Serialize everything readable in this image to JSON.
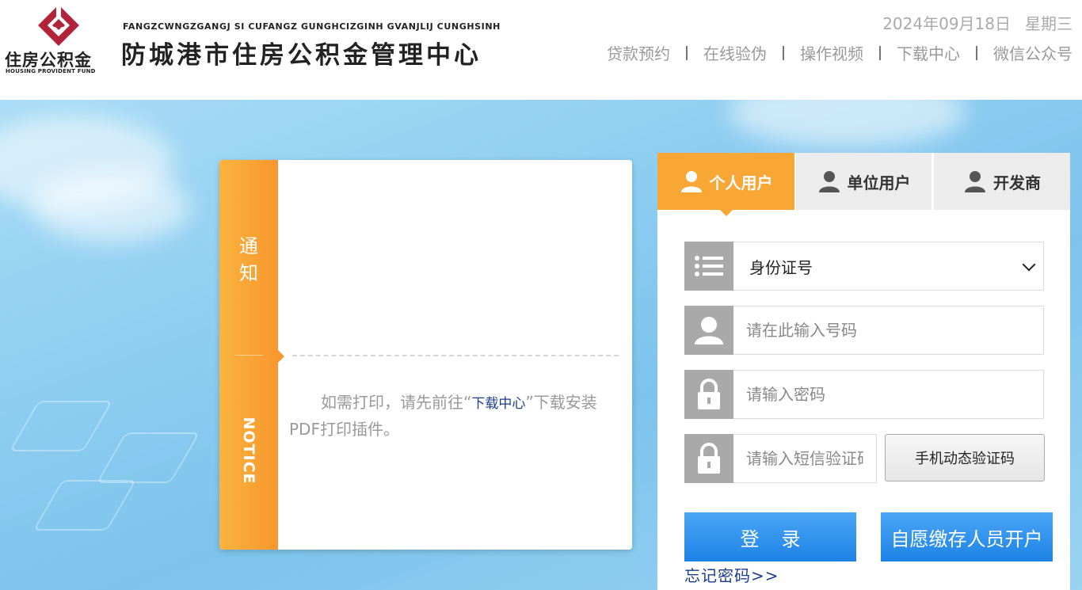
{
  "header": {
    "logo_cn": "住房公积金",
    "logo_en": "HOUSING PROVIDENT FUND",
    "site_pinyin": "FANGZCWNGZGANGJ SI CUFANGZ GUNGHCIZGINH GVANJLIJ CUNGHSINH",
    "site_title": "防城港市住房公积金管理中心",
    "date": "2024年09月18日",
    "weekday": "星期三",
    "nav": [
      "贷款预约",
      "在线验伪",
      "操作视频",
      "下载中心",
      "微信公众号"
    ]
  },
  "notice": {
    "side_cn": "通知",
    "side_en": "NOTICE",
    "text_before": "如需打印，请先前往“",
    "link": "下载中心",
    "text_after": "”下载安装PDF打印插件。"
  },
  "login": {
    "tabs": [
      "个人用户",
      "单位用户",
      "开发商"
    ],
    "active_tab": 0,
    "id_type": "身份证号",
    "id_placeholder": "请在此输入号码",
    "password_placeholder": "请输入密码",
    "sms_placeholder": "请输入短信验证码",
    "sms_button": "手机动态验证码",
    "login_button": "登录",
    "open_account_button": "自愿缴存人员开户",
    "forgot_link": "忘记密码>>"
  },
  "colors": {
    "accent_orange": "#f9a734",
    "button_blue": "#2a8fec",
    "link_blue": "#1a3d8f"
  }
}
